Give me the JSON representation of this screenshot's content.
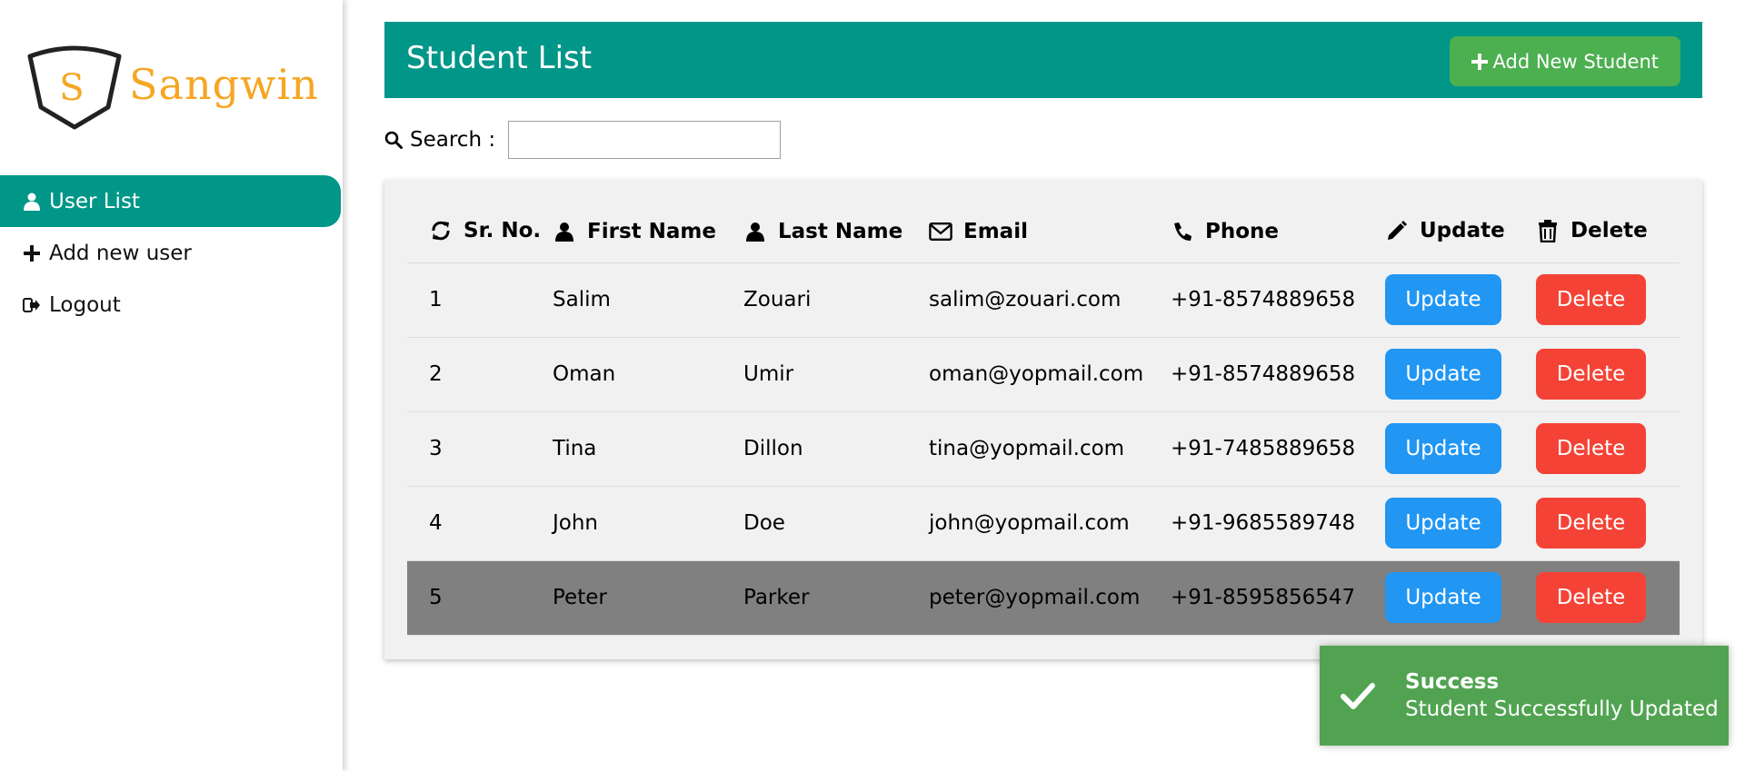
{
  "brand": {
    "logo_letter": "S",
    "name": "Sangwin",
    "color": "#F5A623"
  },
  "sidebar": {
    "items": [
      {
        "label": "User List",
        "icon": "user-icon",
        "active": true
      },
      {
        "label": "Add new user",
        "icon": "plus-icon",
        "active": false
      },
      {
        "label": "Logout",
        "icon": "sign-out-icon",
        "active": false
      }
    ]
  },
  "header": {
    "title": "Student List",
    "add_button_label": "Add New Student",
    "color": "#009688"
  },
  "search": {
    "label": "Search :",
    "value": ""
  },
  "table": {
    "columns": [
      {
        "label": "Sr. No.",
        "icon": "refresh-icon"
      },
      {
        "label": "First Name",
        "icon": "user-icon"
      },
      {
        "label": "Last Name",
        "icon": "user-icon"
      },
      {
        "label": "Email",
        "icon": "envelope-icon"
      },
      {
        "label": "Phone",
        "icon": "phone-icon"
      },
      {
        "label": "Update",
        "icon": "pencil-icon"
      },
      {
        "label": "Delete",
        "icon": "trash-icon"
      }
    ],
    "rows": [
      {
        "sr": "1",
        "first": "Salim",
        "last": "Zouari",
        "email": "salim@zouari.com",
        "phone": "+91-8574889658",
        "update": "Update",
        "delete": "Delete"
      },
      {
        "sr": "2",
        "first": "Oman",
        "last": "Umir",
        "email": "oman@yopmail.com",
        "phone": "+91-8574889658",
        "update": "Update",
        "delete": "Delete"
      },
      {
        "sr": "3",
        "first": "Tina",
        "last": "Dillon",
        "email": "tina@yopmail.com",
        "phone": "+91-7485889658",
        "update": "Update",
        "delete": "Delete"
      },
      {
        "sr": "4",
        "first": "John",
        "last": "Doe",
        "email": "john@yopmail.com",
        "phone": "+91-9685589748",
        "update": "Update",
        "delete": "Delete"
      },
      {
        "sr": "5",
        "first": "Peter",
        "last": "Parker",
        "email": "peter@yopmail.com",
        "phone": "+91-8595856547",
        "update": "Update",
        "delete": "Delete"
      }
    ],
    "highlighted_row": 5
  },
  "toast": {
    "title": "Success",
    "message": "Student Successfully Updated",
    "icon": "checkmark-icon",
    "color": "#51A351"
  }
}
